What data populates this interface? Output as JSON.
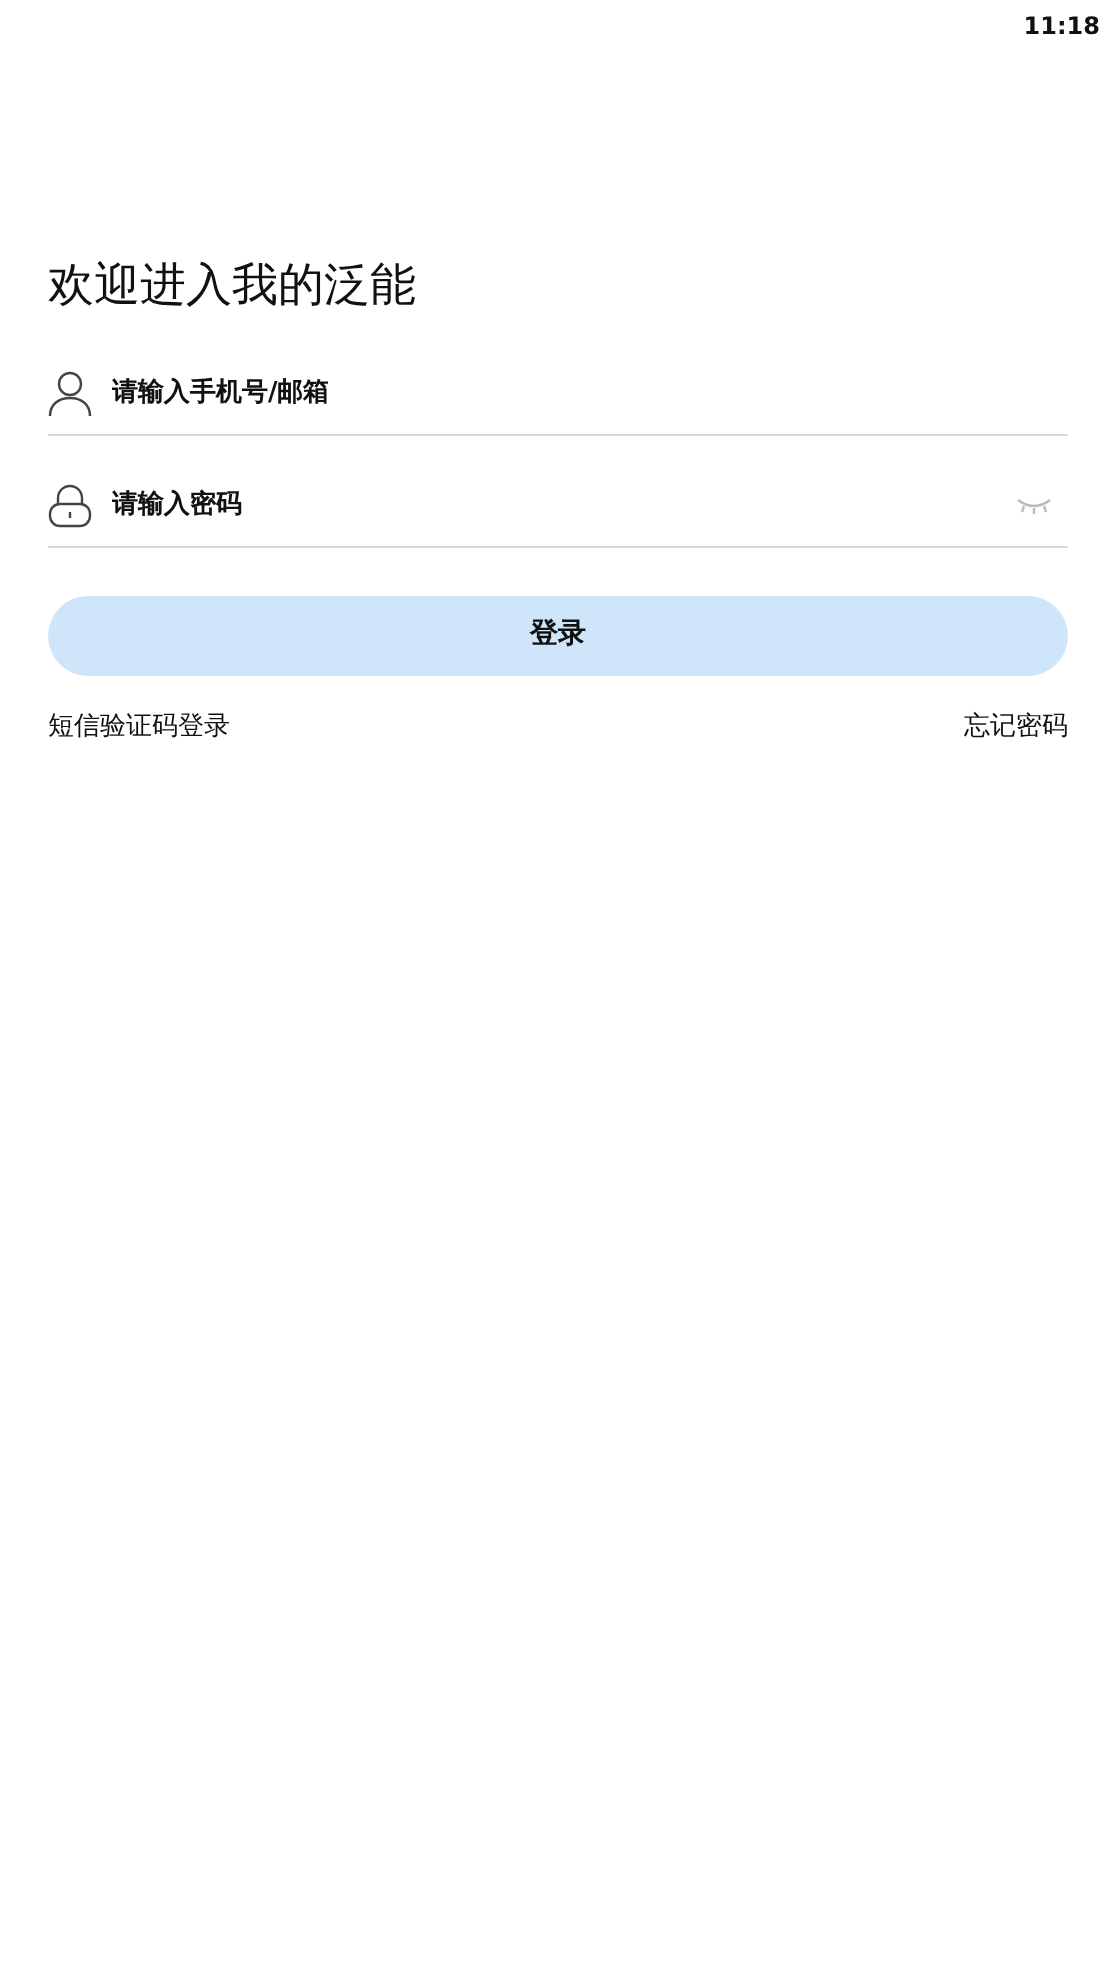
{
  "status_bar": {
    "time": "11:18"
  },
  "title": "欢迎进入我的泛能",
  "fields": [
    {
      "kind": "account",
      "placeholder": "请输入手机号/邮箱"
    },
    {
      "kind": "password",
      "placeholder": "请输入密码"
    }
  ],
  "login_button": "登录",
  "links": [
    "短信验证码登录",
    "忘记密码"
  ]
}
